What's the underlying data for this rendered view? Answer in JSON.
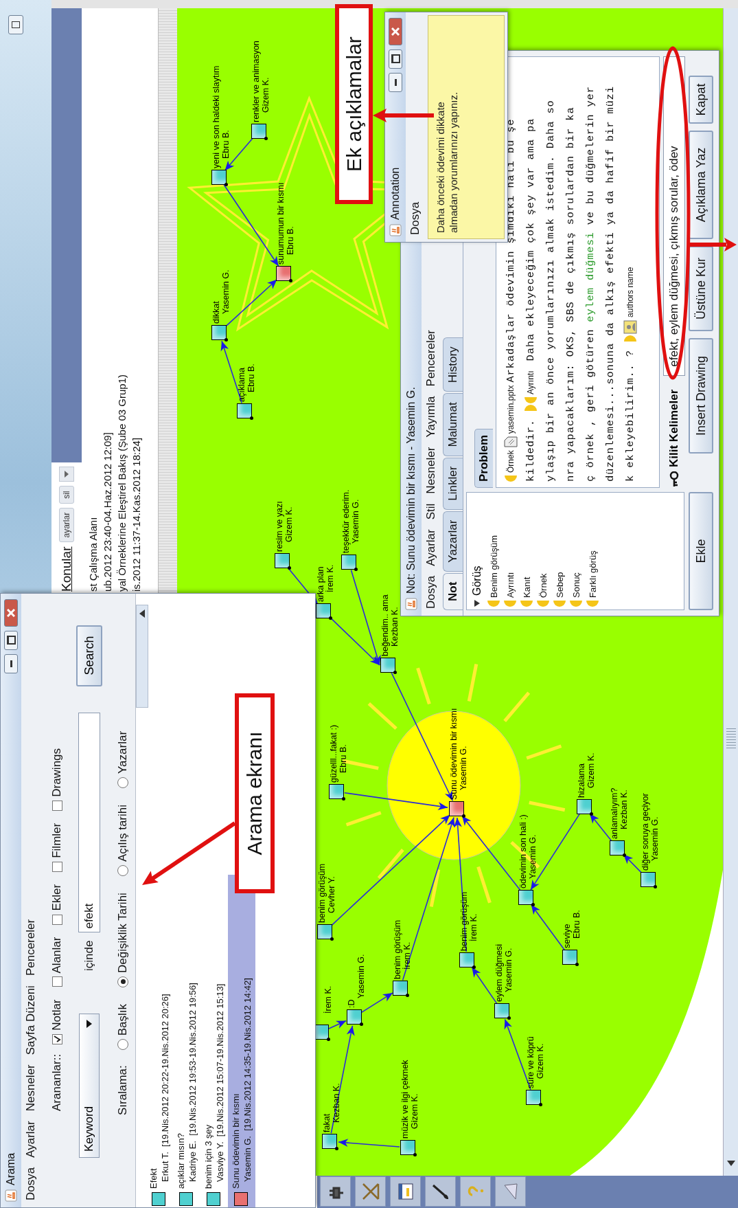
{
  "main_window": {
    "header": {
      "title": "Konular",
      "buttons": [
        "ayarlar",
        "sil"
      ]
    },
    "items": [
      "st Çalışma Alanı",
      "ub.2012 23:40-04.Haz.2012 12:09]",
      "yal Örneklerine Eleştirel Bakış (Şube 03 Grup1)",
      "is.2012 11:37-14.Kas.2012 18:24]"
    ]
  },
  "map": {
    "nodes": [
      {
        "title": "yeni ve son haldeki slaytım",
        "author": "Ebru B.",
        "color": "#4fd0d0"
      },
      {
        "title": "renkler ve animasyon",
        "author": "Gizem K.",
        "color": "#4fd0d0"
      },
      {
        "title": "sunumumun bir kısmı",
        "author": "Ebru B.",
        "color": "#e87070"
      },
      {
        "title": "dikkat",
        "author": "Yasemin G.",
        "color": "#4fd0d0"
      },
      {
        "title": "açıklama",
        "author": "Ebru B.",
        "color": "#4fd0d0"
      },
      {
        "title": "resim ve yazı",
        "author": "Gizem K.",
        "color": "#4fd0d0"
      },
      {
        "title": "teşekkür ederim.",
        "author": "Yasemin G.",
        "color": "#4fd0d0"
      },
      {
        "title": "arka plan",
        "author": "İrem K.",
        "color": "#4fd0d0"
      },
      {
        "title": "beğendim.. ama",
        "author": "Kezban K.",
        "color": "#4fd0d0"
      },
      {
        "title": "güzelll...fakat :)",
        "author": "Ebru B.",
        "color": "#4fd0d0"
      },
      {
        "title": "Sunu ödevimin bir kısmı",
        "author": "Yasemin G.",
        "color": "#e87070"
      },
      {
        "title": "benim görüşüm",
        "author": "Cevher Y.",
        "color": "#4fd0d0"
      },
      {
        "author": "İrem K.",
        "color": "#4fd0d0"
      },
      {
        "title": ":D",
        "author": "Yasemin G.",
        "color": "#4fd0d0"
      },
      {
        "title": "benim görüşüm",
        "author": "İrem K.",
        "color": "#4fd0d0"
      },
      {
        "title": "benim görüşüm",
        "author": "İrem K.",
        "color": "#4fd0d0"
      },
      {
        "title": "ödevimin son hali :)",
        "author": "Yasemin G.",
        "color": "#4fd0d0"
      },
      {
        "title": "hizalama",
        "author": "Gizem K.",
        "color": "#4fd0d0"
      },
      {
        "title": "anlamalıyım?",
        "author": "Kezban K.",
        "color": "#4fd0d0"
      },
      {
        "title": "diğer soruya geçiyor",
        "author": "Yasemin G.",
        "color": "#4fd0d0"
      },
      {
        "title": "seviye",
        "author": "Ebru B.",
        "color": "#4fd0d0"
      },
      {
        "title": "eylem düğmesi",
        "author": "Yasemin G.",
        "color": "#4fd0d0"
      },
      {
        "title": "süre ve köprü",
        "author": "Gizem K.",
        "color": "#4fd0d0"
      },
      {
        "title": "fakat",
        "author": "Kezban K.",
        "color": "#4fd0d0"
      },
      {
        "title": "müzik ve ilgi çekmek",
        "author": "Gizem K.",
        "color": "#4fd0d0"
      }
    ]
  },
  "search_window": {
    "title": "Arama",
    "menu": [
      "Dosya",
      "Ayarlar",
      "Nesneler",
      "Sayfa Düzeni",
      "Pencereler"
    ],
    "searched_label": "Arananlar::",
    "filters": [
      {
        "label": "Notlar",
        "checked": true
      },
      {
        "label": "Alanlar",
        "checked": false
      },
      {
        "label": "Ekler",
        "checked": false
      },
      {
        "label": "Filmler",
        "checked": false
      },
      {
        "label": "Drawings",
        "checked": false
      }
    ],
    "field_dropdown": "Keyword",
    "in_label": "içinde",
    "query": "efekt",
    "search_button": "Search",
    "sort_label": "Sıralama:",
    "sort_options": [
      {
        "label": "Başlık",
        "selected": false
      },
      {
        "label": "Değişiklik Tarihi",
        "selected": true
      },
      {
        "label": "Açılış tarihi",
        "selected": false
      },
      {
        "label": "Yazarlar",
        "selected": false
      }
    ],
    "results": [
      {
        "title": "Efekt",
        "detail": "Erkut T.  [19.Nis.2012 20:22-19.Nis.2012 20:26]",
        "color": "#4fd0d0",
        "selected": false
      },
      {
        "title": "açıklar mısın?",
        "detail": "Kadriye E.  [19.Nis.2012 19:53-19.Nis.2012 19:56]",
        "color": "#4fd0d0",
        "selected": false
      },
      {
        "title": "benim için 3 şey",
        "detail": "Vasviye Y.  [19.Nis.2012 15:07-19.Nis.2012 15:13]",
        "color": "#4fd0d0",
        "selected": false
      },
      {
        "title": "Sunu ödevimin bir kısmı",
        "detail": "Yasemin G.  [19.Nis.2012 14:35-19.Nis.2012 14:42]",
        "color": "#e87070",
        "selected": true
      }
    ]
  },
  "note_window": {
    "title": "Not: Sunu ödevimin bir kısmı - Yasemin G.",
    "menu": [
      "Dosya",
      "Ayarlar",
      "Stil",
      "Nesneler",
      "Yayımla",
      "Pencereler"
    ],
    "tabs": [
      {
        "label": "Not",
        "selected": true
      },
      {
        "label": "Yazarlar",
        "selected": false
      },
      {
        "label": "Linkler",
        "selected": false
      },
      {
        "label": "Malumat",
        "selected": false
      },
      {
        "label": "History",
        "selected": false
      }
    ],
    "tree": {
      "label": "Görüş",
      "expanded": true,
      "children": [
        {
          "label": "Benim görüşüm"
        },
        {
          "label": "Ayrıntı"
        },
        {
          "label": "Kanıt"
        },
        {
          "label": "Örnek"
        },
        {
          "label": "Sebep"
        },
        {
          "label": "Sonuç"
        },
        {
          "label": "Farklı görüş"
        }
      ]
    },
    "left_button": "Ekle",
    "content_tab": "Problem",
    "lines": [
      {
        "parts": [
          {
            "kind": "tag",
            "text": "Örnek"
          },
          {
            "kind": "file",
            "text": "yasemin.pptx"
          },
          {
            "kind": "text",
            "text": "Arkadaşlar ödevimin şimdiki hali bu şe"
          }
        ]
      },
      {
        "parts": [
          {
            "kind": "text",
            "text": "kildedir. "
          },
          {
            "kind": "close"
          },
          {
            "kind": "tag",
            "text": "Ayrıntı"
          },
          {
            "kind": "text",
            "text": " Daha ekleyeceğim çok şey var ama pa"
          }
        ]
      },
      {
        "parts": [
          {
            "kind": "text",
            "text": "ylaşıp bir an önce yorumlarınızı almak istedim. Daha so"
          }
        ]
      },
      {
        "parts": [
          {
            "kind": "text",
            "text": "nra yapacaklarım: OKS, SBS de çıkmış sorulardan bir ka"
          }
        ]
      },
      {
        "parts": [
          {
            "kind": "text",
            "text": "ç örnek , geri götüren "
          },
          {
            "kind": "highlight",
            "text": "eylem düğmesi"
          },
          {
            "kind": "text",
            "text": " ve bu düğmelerin yer"
          }
        ]
      },
      {
        "parts": [
          {
            "kind": "text",
            "text": "düzenlemesi...sonuna da alkış efekti ya da hafif bir müzi"
          }
        ]
      },
      {
        "parts": [
          {
            "kind": "text",
            "text": "k ekleyebilirim.. ? "
          },
          {
            "kind": "close"
          },
          {
            "kind": "author",
            "text": "authors name"
          }
        ]
      }
    ],
    "keywords_label": "Kilit Kelimeler",
    "keywords": "efekt, eylem düğmesi, çıkmış sorular, ödev",
    "buttons": [
      "Insert Drawing",
      "Üstüne Kur",
      "Açıklama Yaz",
      "Kapat"
    ]
  },
  "annotation_window": {
    "title": "Annotation",
    "menu": [
      "Dosya"
    ],
    "text": "Daha önceki ödevimi dikkate almadan yorumlarınızı yapınız."
  },
  "callouts": [
    {
      "text": "Arama ekranı"
    },
    {
      "text": "Ek açıklamalar"
    }
  ]
}
